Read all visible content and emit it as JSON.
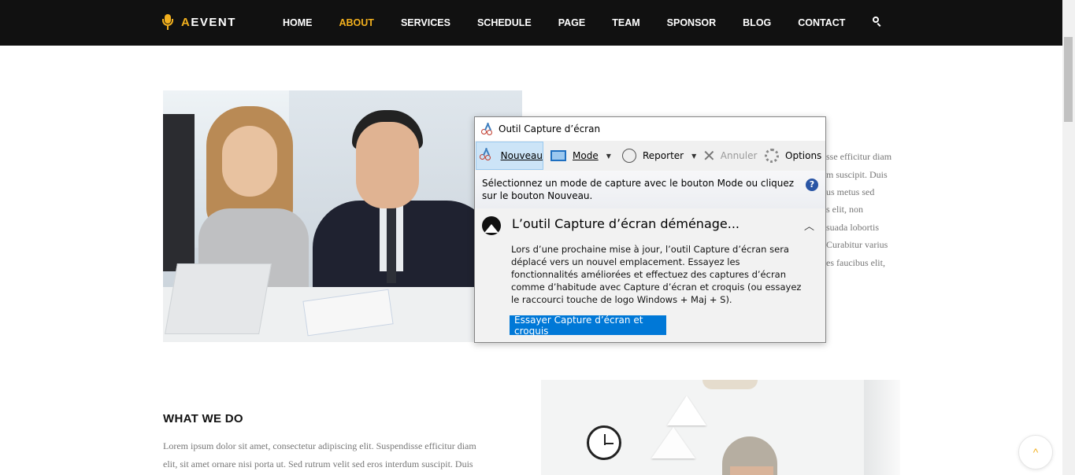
{
  "nav": {
    "logo_a": "A",
    "logo_rest": "EVENT",
    "items": [
      "HOME",
      "ABOUT",
      "SERVICES",
      "SCHEDULE",
      "PAGE",
      "TEAM",
      "SPONSOR",
      "BLOG",
      "CONTACT"
    ],
    "active": "ABOUT",
    "search_icon": "search-icon"
  },
  "right_fragments": [
    "sse efficitur diam",
    "m suscipit. Duis",
    "us metus sed",
    "s elit, non",
    "suada lobortis",
    "Curabitur varius",
    "es faucibus elit,"
  ],
  "what": {
    "title": "WHAT WE DO",
    "line1": "Lorem ipsum dolor sit amet, consectetur adipiscing elit. Suspendisse efficitur diam",
    "line2": "elit, sit amet ornare nisi porta ut. Sed rutrum velit sed eros interdum suscipit. Duis"
  },
  "back_to_top": "^",
  "snip": {
    "title": "Outil Capture d’écran",
    "toolbar": {
      "new": "Nouveau",
      "mode": "Mode",
      "delay": "Reporter",
      "cancel": "Annuler",
      "options": "Options"
    },
    "info": "Sélectionnez un mode de capture avec le bouton Mode ou cliquez sur le bouton Nouveau.",
    "help": "?",
    "move_title": "L’outil Capture d’écran déménage...",
    "move_body": "Lors d’une prochaine mise à jour, l’outil Capture d’écran sera déplacé vers un nouvel emplacement. Essayez les fonctionnalités améliorées et effectuez des captures d’écran comme d’habitude avec Capture d’écran et croquis (ou essayez le raccourci touche de logo Windows + Maj + S).",
    "try_button": "Essayer Capture d’écran et croquis"
  },
  "colors": {
    "accent": "#f2b01e",
    "nav_bg": "#111111",
    "button_blue": "#0078d7"
  }
}
